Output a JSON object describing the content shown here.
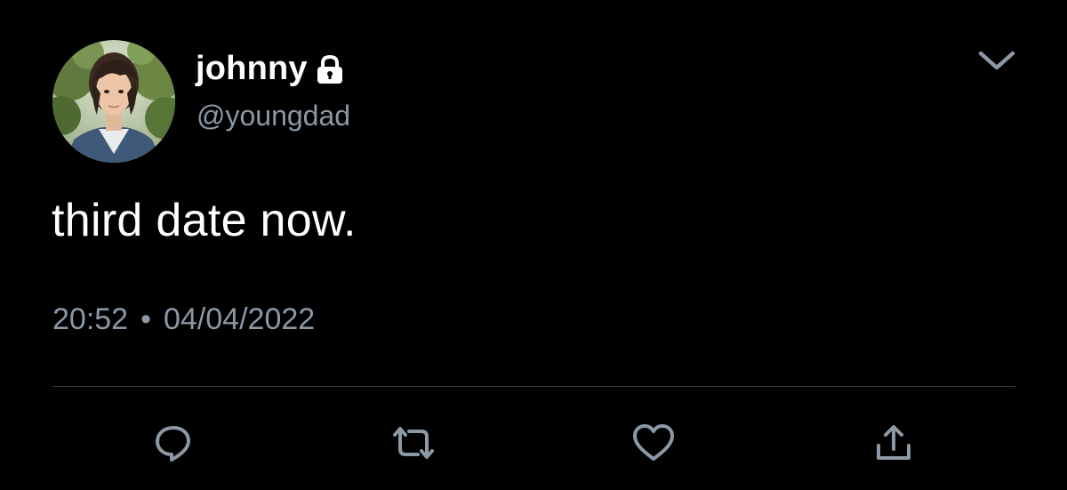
{
  "tweet": {
    "author": {
      "display_name": "johnny",
      "handle": "@youngdad",
      "protected_icon": "lock-icon",
      "avatar": "profile-photo"
    },
    "text": "third date now.",
    "time": "20:52",
    "separator": "•",
    "date": "04/04/2022",
    "menu_icon": "chevron-down-icon",
    "actions": [
      {
        "name": "reply",
        "icon": "reply-icon"
      },
      {
        "name": "retweet",
        "icon": "retweet-icon"
      },
      {
        "name": "like",
        "icon": "heart-icon"
      },
      {
        "name": "share",
        "icon": "share-icon"
      }
    ]
  },
  "colors": {
    "background": "#000000",
    "primary_text": "#ffffff",
    "secondary_text": "#8b98a5",
    "divider": "#3a3f44"
  }
}
